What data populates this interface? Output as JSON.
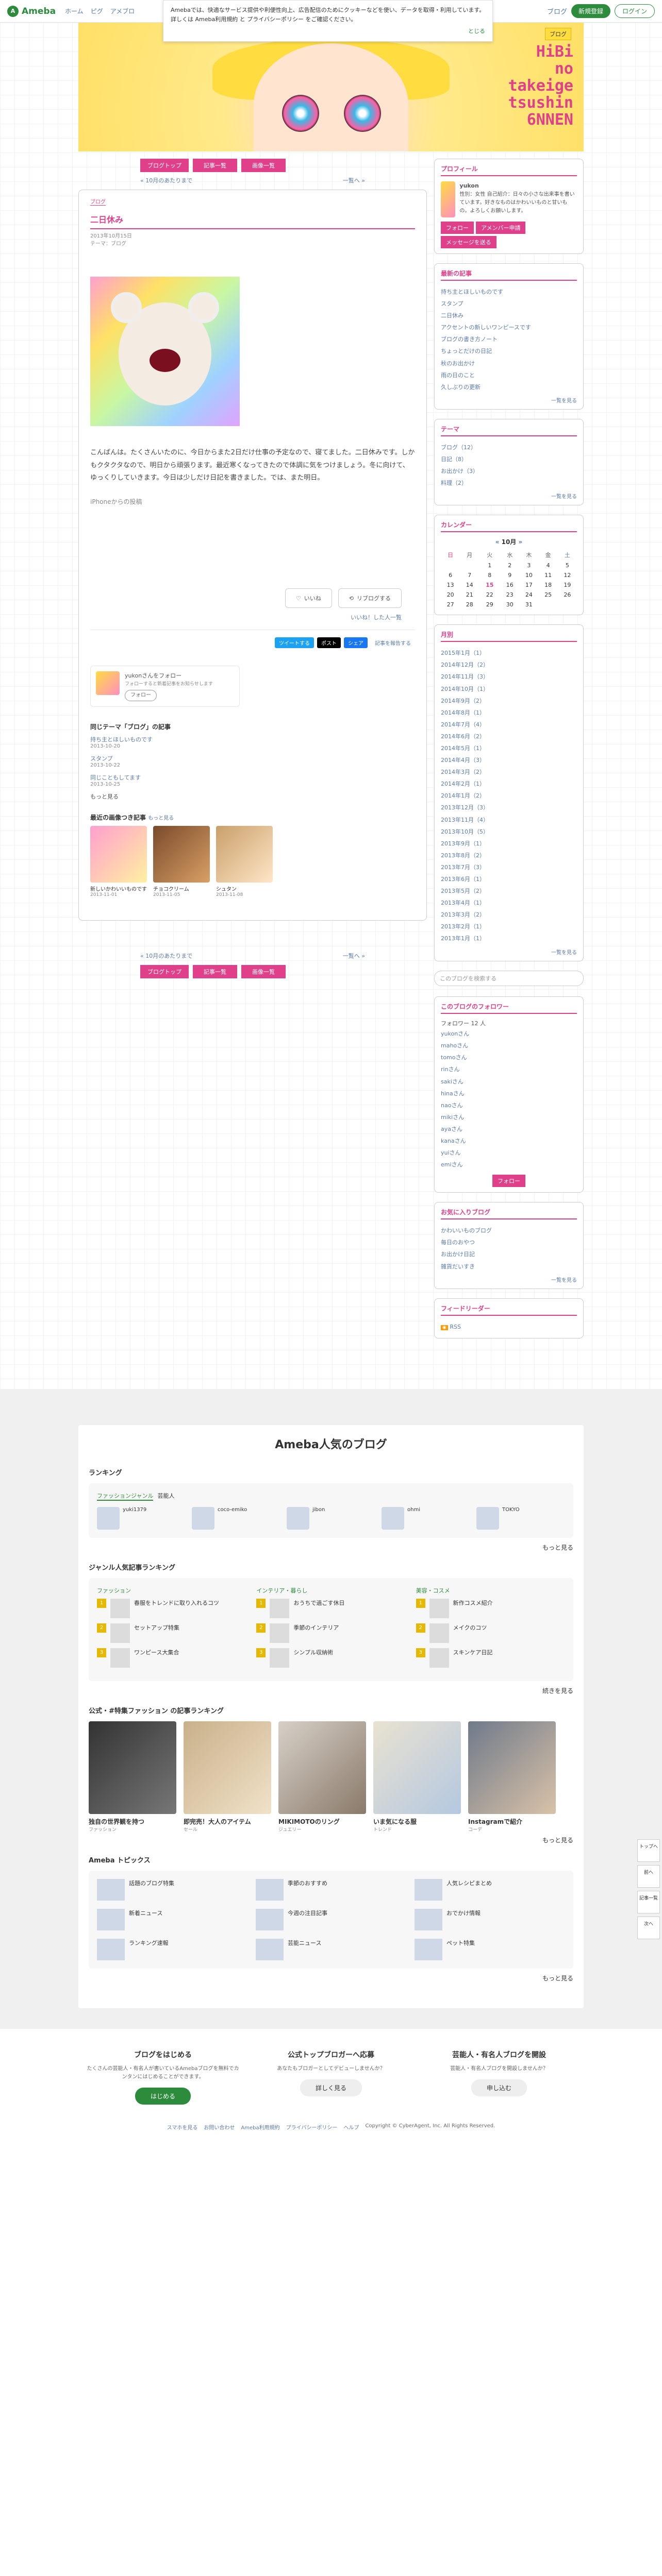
{
  "topbar": {
    "logo": "Ameba",
    "nav": [
      "ホーム",
      "ピグ",
      "アメブロ"
    ],
    "account": "ブログ",
    "signup": "新規登録",
    "login": "ログイン"
  },
  "cookie": {
    "text": "Amebaでは、快適なサービス提供や利便性向上、広告配信のためにクッキーなどを使い、データを取得・利用しています。詳しくは Ameba利用規約 と プライバシーポリシー をご確認ください。",
    "close": "とじる"
  },
  "header": {
    "title_lines": [
      "HiBi",
      "no",
      "takeige",
      "tsushin",
      "6NNEN"
    ],
    "blog_btn": "ブログ"
  },
  "entry": {
    "buttons": [
      "ブログトップ",
      "記事一覧",
      "画像一覧"
    ],
    "prev": "« 10月のあたりまで",
    "next": "一覧へ »",
    "theme": "ブログ",
    "title": "二日休み",
    "date": "2013年10月15日",
    "theme_label": "テーマ：ブログ",
    "body": "こんばんは。たくさんいたのに、今日からまた2日だけ仕事の予定なので、寝てました。二日休みです。しかもクタクタなので、明日から頑張ります。最近寒くなってきたので体調に気をつけましょう。冬に向けて、ゆっくりしていきます。今日は少しだけ日記を書きました。では、また明日。",
    "from": "iPhoneからの投稿",
    "like": "いいね",
    "reblog": "リブログする",
    "like_count": "いいね！した人一覧",
    "share": [
      "ツイートする",
      "ポスト",
      "シェア",
      "記事を報告する"
    ],
    "follow_name": "yukonさんをフォロー",
    "follow_desc": "フォローすると新着記事をお知らせします",
    "follow_btn": "フォロー",
    "related_title": "同じテーマ「ブログ」の記事",
    "related": [
      {
        "t": "持ち主とほしいものです",
        "d": "2013-10-20"
      },
      {
        "t": "スタンプ",
        "d": "2013-10-22"
      },
      {
        "t": "同じこともしてます",
        "d": "2013-10-25"
      }
    ],
    "related_more": "もっと見る",
    "rec_title": "最近の画像つき記事",
    "rec_more": "もっと見る",
    "recs": [
      {
        "t": "新しいかわいいものです",
        "d": "2013-11-01"
      },
      {
        "t": "チョコクリーム",
        "d": "2013-11-05"
      },
      {
        "t": "シュタン",
        "d": "2013-11-08"
      }
    ]
  },
  "side": {
    "profile_h": "プロフィール",
    "profile_name": "yukon",
    "profile_desc": "性別：女性 自己紹介：日々の小さな出来事を書いています。好きなものはかわいいものと甘いもの。よろしくお願いします。",
    "profile_btns": [
      "フォロー",
      "アメンバー申請",
      "メッセージを送る"
    ],
    "recent_h": "最新の記事",
    "recent": [
      "持ち主とほしいものです",
      "スタンプ",
      "二日休み",
      "アクセントの新しいワンピースです",
      "ブログの書き方ノート",
      "ちょっとだけの日記",
      "秋のお出かけ",
      "雨の日のこと",
      "久しぶりの更新"
    ],
    "recent_more": "一覧を見る",
    "theme_h": "テーマ",
    "themes": [
      "ブログ（12）",
      "日記（8）",
      "お出かけ（3）",
      "料理（2）"
    ],
    "theme_more": "一覧を見る",
    "cal_h": "カレンダー",
    "cal_month": "10月",
    "cal_days": [
      "日",
      "月",
      "火",
      "水",
      "木",
      "金",
      "土"
    ],
    "cal": [
      [
        "",
        "",
        "1",
        "2",
        "3",
        "4",
        "5"
      ],
      [
        "6",
        "7",
        "8",
        "9",
        "10",
        "11",
        "12"
      ],
      [
        "13",
        "14",
        "15",
        "16",
        "17",
        "18",
        "19"
      ],
      [
        "20",
        "21",
        "22",
        "23",
        "24",
        "25",
        "26"
      ],
      [
        "27",
        "28",
        "29",
        "30",
        "31",
        "",
        ""
      ]
    ],
    "archive_h": "月別",
    "archive": [
      "2015年1月（1）",
      "2014年12月（2）",
      "2014年11月（3）",
      "2014年10月（1）",
      "2014年9月（2）",
      "2014年8月（1）",
      "2014年7月（4）",
      "2014年6月（2）",
      "2014年5月（1）",
      "2014年4月（3）",
      "2014年3月（2）",
      "2014年2月（1）",
      "2014年1月（2）",
      "2013年12月（3）",
      "2013年11月（4）",
      "2013年10月（5）",
      "2013年9月（1）",
      "2013年8月（2）",
      "2013年7月（3）",
      "2013年6月（1）",
      "2013年5月（2）",
      "2013年4月（1）",
      "2013年3月（2）",
      "2013年2月（1）",
      "2013年1月（1）"
    ],
    "archive_more": "一覧を見る",
    "search_ph": "このブログを検索する",
    "followers_h": "このブログのフォロワー",
    "followers_count": "フォロワー 12 人",
    "followers": [
      "yukonさん",
      "mahoさん",
      "tomoさん",
      "rinさん",
      "sakiさん",
      "hinaさん",
      "naoさん",
      "mikiさん",
      "ayaさん",
      "kanaさん",
      "yuiさん",
      "emiさん"
    ],
    "follow_btn": "フォロー",
    "fav_h": "お気に入りブログ",
    "favs": [
      "かわいいものブログ",
      "毎日のおやつ",
      "お出かけ日記",
      "雑貨だいすき"
    ],
    "favs_more": "一覧を見る",
    "feed_h": "フィードリーダー",
    "feed": "RSS"
  },
  "popular": {
    "title": "Ameba人気のブログ",
    "ranking_h": "ランキング",
    "tab": "ファッションジャンル",
    "tab2": "芸能人",
    "blogs": [
      "yuki1379",
      "coco-emiko",
      "jibon",
      "ohmi",
      "TOKYO"
    ],
    "more": "もっと見る",
    "genre_h": "ジャンル人気記事ランキング",
    "cols": [
      "ファッション",
      "インテリア・暮らし",
      "美容・コスメ"
    ],
    "rank_items": [
      [
        "春服をトレンドに取り入れるコツ",
        "セットアップ特集",
        "ワンピース大集合"
      ],
      [
        "おうちで過ごす休日",
        "季節のインテリア",
        "シンプル収納術"
      ],
      [
        "新作コスメ紹介",
        "メイクのコツ",
        "スキンケア日記"
      ]
    ],
    "rank_more": "続きを見る",
    "feat_h": "公式・#特集ファッション の記事ランキング",
    "feats": [
      {
        "t": "独自の世界観を持つ",
        "s": "ファッション"
      },
      {
        "t": "即完売！大人のアイテム",
        "s": "セール"
      },
      {
        "t": "MIKIMOTOのリング",
        "s": "ジュエリー"
      },
      {
        "t": "いま気になる服",
        "s": "トレンド"
      },
      {
        "t": "Instagramで紹介",
        "s": "コーデ"
      }
    ],
    "feat_more": "もっと見る",
    "topics_h": "Ameba トピックス",
    "topics": [
      "話題のブログ特集",
      "季節のおすすめ",
      "人気レシピまとめ",
      "新着ニュース",
      "今週の注目記事",
      "おでかけ情報",
      "ランキング速報",
      "芸能ニュース",
      "ペット特集"
    ],
    "topics_more": "もっと見る"
  },
  "cta": [
    {
      "h": "ブログをはじめる",
      "p": "たくさんの芸能人・有名人が書いているAmebaブログを無料でカンタンにはじめることができます。",
      "b": "はじめる"
    },
    {
      "h": "公式トップブロガーへ応募",
      "p": "あなたもブロガーとしてデビューしませんか？",
      "b": "詳しく見る"
    },
    {
      "h": "芸能人・有名人ブログを開設",
      "p": "芸能人・有名人ブログを開設しませんか？",
      "b": "申し込む"
    }
  ],
  "footer": [
    "スマホを見る",
    "お問い合わせ",
    "Ameba利用規約",
    "プライバシーポリシー",
    "ヘルプ"
  ],
  "copyright": "Copyright © CyberAgent, Inc. All Rights Reserved.",
  "floats": [
    "トップへ",
    "前へ",
    "記事一覧",
    "次へ"
  ]
}
